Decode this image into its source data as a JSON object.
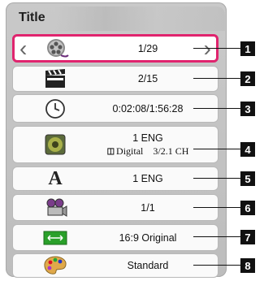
{
  "title": "Title",
  "rows": [
    {
      "value": "1/29",
      "icon": "film-reel-icon",
      "callout": "1"
    },
    {
      "value": "2/15",
      "icon": "clapperboard-icon",
      "callout": "2"
    },
    {
      "value": "0:02:08/1:56:28",
      "icon": "clock-icon",
      "callout": "3"
    },
    {
      "value": "1 ENG",
      "sub_left": "Digital",
      "sub_right": "3/2.1 CH",
      "icon": "speaker-icon",
      "callout": "4"
    },
    {
      "value": "1 ENG",
      "icon": "subtitle-a-icon",
      "callout": "5"
    },
    {
      "value": "1/1",
      "icon": "camera-angle-icon",
      "callout": "6"
    },
    {
      "value": "16:9 Original",
      "icon": "aspect-ratio-icon",
      "callout": "7"
    },
    {
      "value": "Standard",
      "icon": "palette-icon",
      "callout": "8"
    }
  ],
  "selected_row": 0,
  "accent_color": "#e0246e"
}
